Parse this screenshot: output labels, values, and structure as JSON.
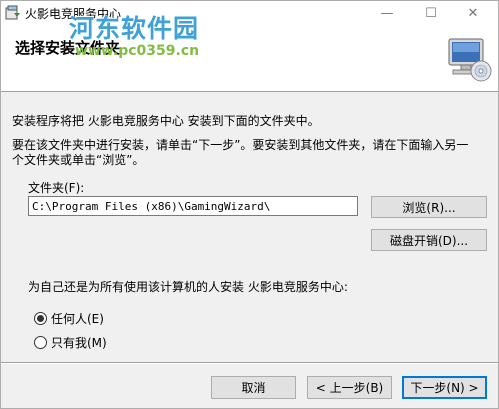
{
  "window": {
    "title": "火影电竞服务中心",
    "minimize_glyph": "—",
    "maximize_glyph": "☐",
    "close_glyph": "✕"
  },
  "watermark": {
    "main": "河东软件园",
    "url": "www.pc0359.cn"
  },
  "header": {
    "title": "选择安装文件夹"
  },
  "body": {
    "intro": "安装程序将把 火影电竞服务中心 安装到下面的文件夹中。",
    "instruction_line1": "要在该文件夹中进行安装，请单击“下一步”。要安装到其他文件夹，请在下面输入另一",
    "instruction_line2": "个文件夹或单击“浏览”。",
    "folder_label": "文件夹(F):",
    "folder_value": "C:\\Program Files (x86)\\GamingWizard\\",
    "browse_label": "浏览(R)...",
    "disk_cost_label": "磁盘开销(D)...",
    "scope_question": "为自己还是为所有使用该计算机的人安装 火影电竞服务中心:",
    "radio_everyone": "任何人(E)",
    "radio_just_me": "只有我(M)"
  },
  "footer": {
    "cancel_label": "取消",
    "back_label": "< 上一步(B)",
    "next_label": "下一步(N) >"
  }
}
